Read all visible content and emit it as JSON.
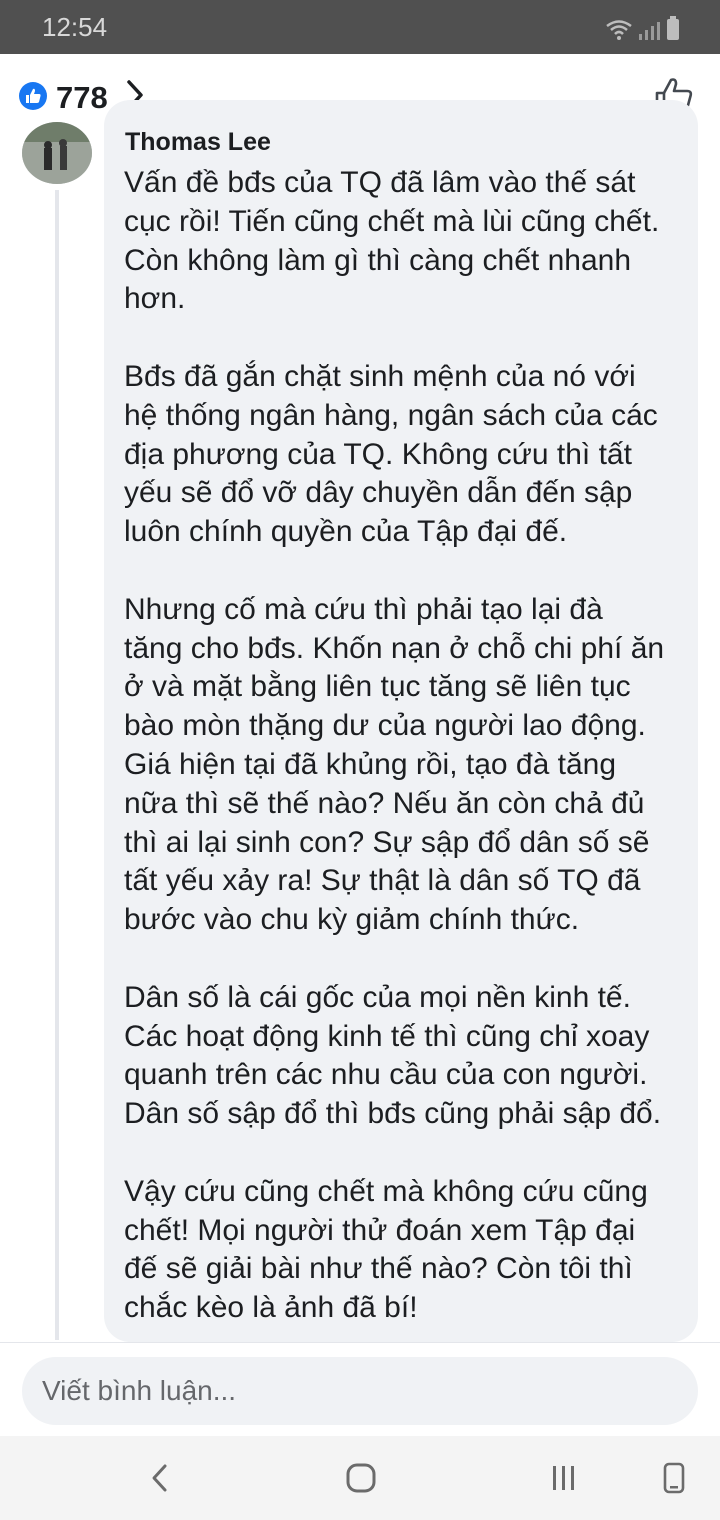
{
  "status_bar": {
    "time": "12:54",
    "icons": [
      "wifi-icon",
      "signal-icon",
      "battery-icon"
    ]
  },
  "header": {
    "like_icon": "like-badge-icon",
    "like_count": "778",
    "chevron_icon": "chevron-right-icon",
    "action_icon": "thumbs-up-outline-icon"
  },
  "comment": {
    "author": "Thomas Lee",
    "paragraphs": [
      "Vấn đề bđs của TQ đã lâm vào thế sát\ncục rồi! Tiến cũng chết mà lùi cũng chết.\nCòn không làm gì thì càng chết nhanh\nhơn.",
      "Bđs đã gắn chặt sinh mệnh của nó với\nhệ thống ngân hàng, ngân sách của các\nđịa phương của TQ. Không cứu thì tất\nyếu sẽ đổ vỡ dây chuyền dẫn đến sập\nluôn chính quyền của Tập đại đế.",
      "Nhưng cố mà cứu thì phải tạo lại đà\ntăng cho bđs. Khốn nạn ở chỗ chi phí ăn\nở và mặt bằng liên tục tăng sẽ liên tục\nbào mòn thặng dư của người lao động.\nGiá hiện tại đã khủng rồi, tạo đà tăng\nnữa thì sẽ thế nào? Nếu ăn còn chả đủ\nthì ai lại sinh con? Sự sập đổ dân số sẽ\ntất yếu xảy ra! Sự thật là dân số TQ đã\nbước vào chu kỳ giảm chính thức.",
      "Dân số là cái gốc của mọi nền kinh tế.\nCác hoạt động kinh tế thì cũng chỉ xoay\nquanh trên các nhu cầu của con người.\nDân số sập đổ thì bđs cũng phải sập đổ.",
      "Vậy cứu cũng chết mà không cứu cũng\nchết! Mọi người thử đoán xem Tập đại\nđế sẽ giải bài như thế nào? Còn tôi thì\nchắc kèo là ảnh đã bí!"
    ]
  },
  "composer": {
    "placeholder": "Viết bình luận..."
  },
  "nav_bar": {
    "icons": [
      "back-icon",
      "home-icon",
      "recents-icon",
      "screen-icon"
    ]
  },
  "colors": {
    "status_bar": "#505050",
    "accent": "#1877f2",
    "bubble": "#f0f2f5",
    "text": "#1c1e21",
    "placeholder": "#65676b"
  }
}
